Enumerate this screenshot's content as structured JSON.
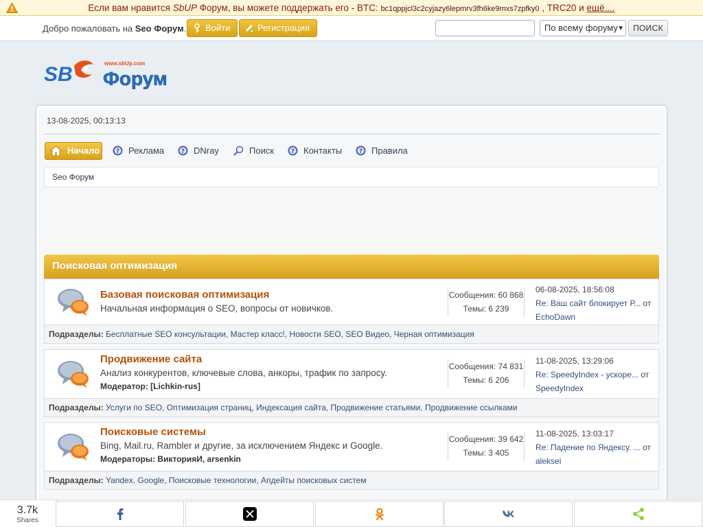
{
  "notice": {
    "text_before": "Если вам нравится ",
    "brand": "SbUP",
    "text_mid": " Форум, вы можете поддержать его - BTC: ",
    "btc_address": "bc1qppjcl3c2cyjazy6lepmrv3fh6ke9mxs7zpfky0",
    "text_after": " , TRC20 и ",
    "more_link": "ещё...."
  },
  "topbar": {
    "welcome_text": "Добро пожаловать на ",
    "site_name": "Seo Форум",
    "welcome_end": ".",
    "login_label": "Войти",
    "register_label": "Регистрация",
    "search_placeholder": "",
    "search_scope": "По всему форуму",
    "search_button": "ПОИСК"
  },
  "logo": {
    "text_url": "www.sbUp.com"
  },
  "header": {
    "datetime": "13-08-2025, 00:13:13"
  },
  "menu": {
    "items": [
      {
        "label": "Начало",
        "icon": "home-icon",
        "active": true
      },
      {
        "label": "Реклама",
        "icon": "help-icon"
      },
      {
        "label": "DNray",
        "icon": "help-icon"
      },
      {
        "label": "Поиск",
        "icon": "search-icon"
      },
      {
        "label": "Контакты",
        "icon": "help-icon"
      },
      {
        "label": "Правила",
        "icon": "help-icon"
      }
    ]
  },
  "breadcrumb": {
    "root": "Seo Форум"
  },
  "category": {
    "title": "Поисковая оптимизация",
    "subboards_label": "Подразделы:",
    "boards": [
      {
        "title": "Базовая поисковая оптимизация",
        "description": "Начальная информация о SEO, вопросы от новичков.",
        "moderators_label": "",
        "moderators": "",
        "posts": "Сообщения: 60 868",
        "topics": "Темы: 6 239",
        "last_date": "06-08-2025, 18:56:08",
        "last_topic": "Re: Ваш сайт блокирует Р...",
        "last_by": " от",
        "last_user": "EchoDawn",
        "subboards": "Бесплатные SEO консультации, Мастер класс!, Новости SEO, SEO Видео, Черная оптимизация"
      },
      {
        "title": "Продвижение сайта",
        "description": "Анализ конкурентов, ключевые слова, анкоры,  трафик по запросу.",
        "moderators_label": "Модератор: ",
        "moderators": "[Lichkin-rus]",
        "posts": "Сообщения: 74 831",
        "topics": "Темы: 6 206",
        "last_date": "11-08-2025, 13:29:06",
        "last_topic": "Re: SpeedyIndex - ускоре...",
        "last_by": " от",
        "last_user": "SpeedyIndex",
        "subboards": "Услуги по SEO, Оптимизация страниц, Индексация сайта, Продвижение статьями, Продвижение ссылками"
      },
      {
        "title": "Поисковые системы",
        "description": "Bing, Mail.ru, Rambler и другие, за исключением Яндекс и Google.",
        "moderators_label": "Модераторы: ",
        "moderators": "ВикторияИ, arsenkin",
        "posts": "Сообщения: 39 642",
        "topics": "Темы: 3 405",
        "last_date": "11-08-2025, 13:03:17",
        "last_topic": "Re: Падение по Яндексу. ...",
        "last_by": " от",
        "last_user": "aleksei",
        "subboards": "Yandex, Google, Поисковые технологии, Апдейты поисковых систем"
      }
    ]
  },
  "sharebar": {
    "count": "3.7k",
    "count_label": "Shares",
    "buttons": [
      "facebook-icon",
      "x-icon",
      "odnoklassniki-icon",
      "vk-icon",
      "share-icon"
    ],
    "colors": {
      "facebook": "#3b5998",
      "x": "#000000",
      "odnoklassniki": "#ee8208",
      "vk": "#4c6c91",
      "share": "#95d03a"
    }
  }
}
